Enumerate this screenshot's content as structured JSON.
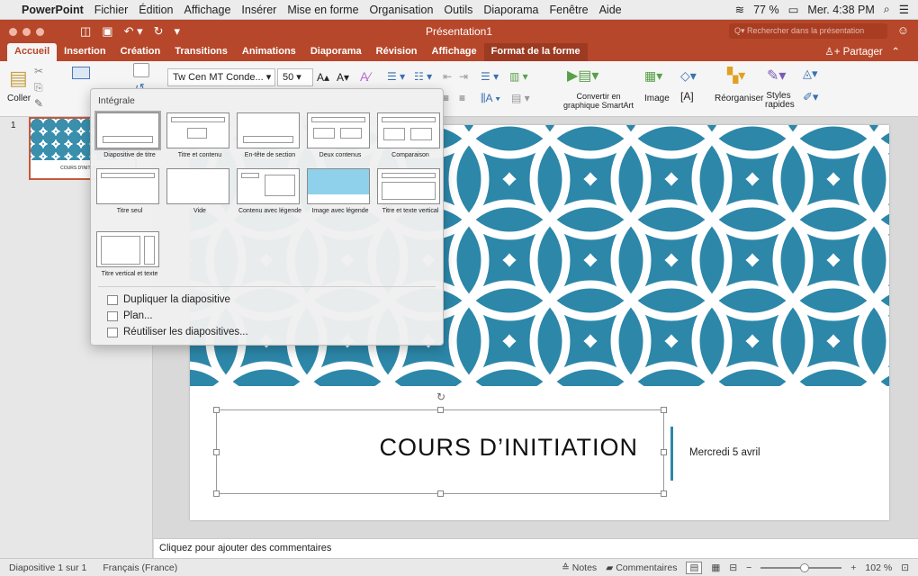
{
  "menubar": {
    "app_name": "PowerPoint",
    "items": [
      "Fichier",
      "Édition",
      "Affichage",
      "Insérer",
      "Mise en forme",
      "Organisation",
      "Outils",
      "Diaporama",
      "Fenêtre",
      "Aide"
    ],
    "battery": "77 %",
    "clock": "Mer. 4:38 PM"
  },
  "titlebar": {
    "doc_title": "Présentation1",
    "search_placeholder": "Rechercher dans la présentation"
  },
  "tabs": [
    "Accueil",
    "Insertion",
    "Création",
    "Transitions",
    "Animations",
    "Diaporama",
    "Révision",
    "Affichage",
    "Format de la forme"
  ],
  "share_label": "Partager",
  "ribbon": {
    "paste_label": "Coller",
    "font_name": "Tw Cen MT Conde...",
    "font_size": "50",
    "smartart_label": "Convertir en graphique SmartArt",
    "image_label": "Image",
    "arrange_label": "Réorganiser",
    "styles_label": "Styles rapides"
  },
  "dropdown": {
    "header": "Intégrale",
    "layouts": [
      "Diapositive de titre",
      "Titre et contenu",
      "En-tête de section",
      "Deux contenus",
      "Comparaison",
      "Titre seul",
      "Vide",
      "Contenu avec légende",
      "Image avec légende",
      "Titre et texte vertical",
      "Titre vertical et texte"
    ],
    "actions": [
      "Dupliquer la diapositive",
      "Plan...",
      "Réutiliser les diapositives..."
    ]
  },
  "thumbnail": {
    "number": "1",
    "title": "COURS D'INITIATION"
  },
  "slide": {
    "title": "COURS D’INITIATION",
    "date": "Mercredi 5 avril",
    "accent_color": "#2c87a9"
  },
  "notes_placeholder": "Cliquez pour ajouter des commentaires",
  "status": {
    "slide_info": "Diapositive 1 sur 1",
    "language": "Français (France)",
    "notes_label": "Notes",
    "comments_label": "Commentaires",
    "zoom": "102 %"
  }
}
